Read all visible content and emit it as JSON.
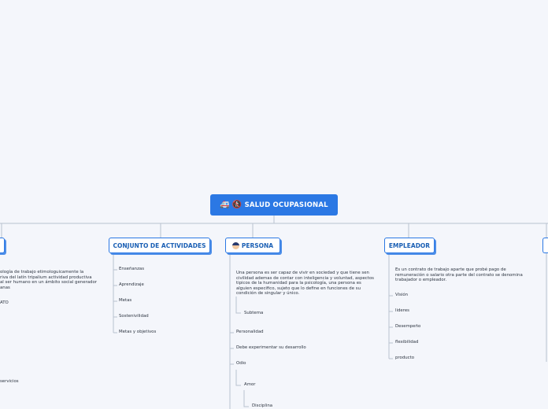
{
  "root": {
    "label": "SALUD OCUPASIONAL",
    "icons": [
      "🚑",
      "🚷"
    ]
  },
  "topics": {
    "conjunto": {
      "label": "CONJUNTO DE ACTIVIDADES",
      "items": [
        "Enseñanzas",
        "Aprendizaje",
        "Metas",
        "Sostenivilidad",
        "Metas y objetivos"
      ]
    },
    "persona": {
      "label": "PERSONA",
      "description": "Una persona es ser capaz de vivir en sociedad y que tiene sen civilidad ademas de contar con inteligencia y voluntad, aspectos tipicos de la humanidad para la psicología, una persona es alguien especifico, sujeto que lo define en funciones de su condición de singular y único.",
      "subtema": "Subtema",
      "items": [
        "Personalidad",
        "Debe experimentar su desarrollo",
        "Odio"
      ],
      "amor": "Amor",
      "disciplina": "Disciplina"
    },
    "empleador": {
      "label": "EMPLEADOR",
      "description": "Es un contrato de trabajo aparte que probé pago de remuneración o salario otra parte del contrato se denomina trabajador o empleador.",
      "items": [
        "Visión",
        "lideres",
        "Desempeño",
        "flexibilidad",
        "producto"
      ]
    },
    "left": {
      "description": "ología de trabajo etimologuicamente la\nriva del latín tripalium actividad productiva\nal ser humano en un ámbito social generador\nanas",
      "item1": "ATO",
      "item2": "servicios"
    }
  }
}
